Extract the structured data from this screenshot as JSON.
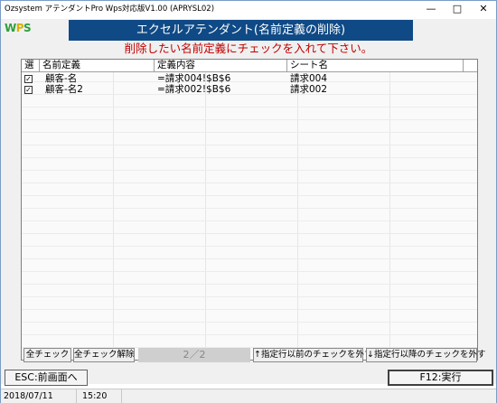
{
  "window": {
    "title": "Ozsystem アテンダントPro Wps対応版V1.00 (APRYSL02)",
    "min_glyph": "—",
    "max_glyph": "□",
    "close_glyph": "✕"
  },
  "logo": {
    "w": "W",
    "p": "P",
    "s": "S"
  },
  "banner": "エクセルアテンダント(名前定義の削除)",
  "instruction": "削除したい名前定義にチェックを入れて下さい。",
  "grid": {
    "headers": [
      "選",
      "名前定義",
      "定義内容",
      "シート名"
    ],
    "rows": [
      {
        "checked": true,
        "check_glyph": "✓",
        "name": "顧客-名",
        "definition": "=請求004!$B$6",
        "sheet": "請求004"
      },
      {
        "checked": true,
        "check_glyph": "✓",
        "name": "顧客-名2",
        "definition": "=請求002!$B$6",
        "sheet": "請求002"
      }
    ]
  },
  "toolbar": {
    "check_all": "全チェック",
    "uncheck_all": "全チェック解除",
    "page": "2／2",
    "uncheck_before": "↑指定行以前のチェックを外す",
    "uncheck_after": "↓指定行以降のチェックを外す"
  },
  "footer": {
    "esc": "ESC:前画面へ",
    "f12": "F12:実行"
  },
  "status": {
    "date": "2018/07/11",
    "time": "15:20"
  }
}
